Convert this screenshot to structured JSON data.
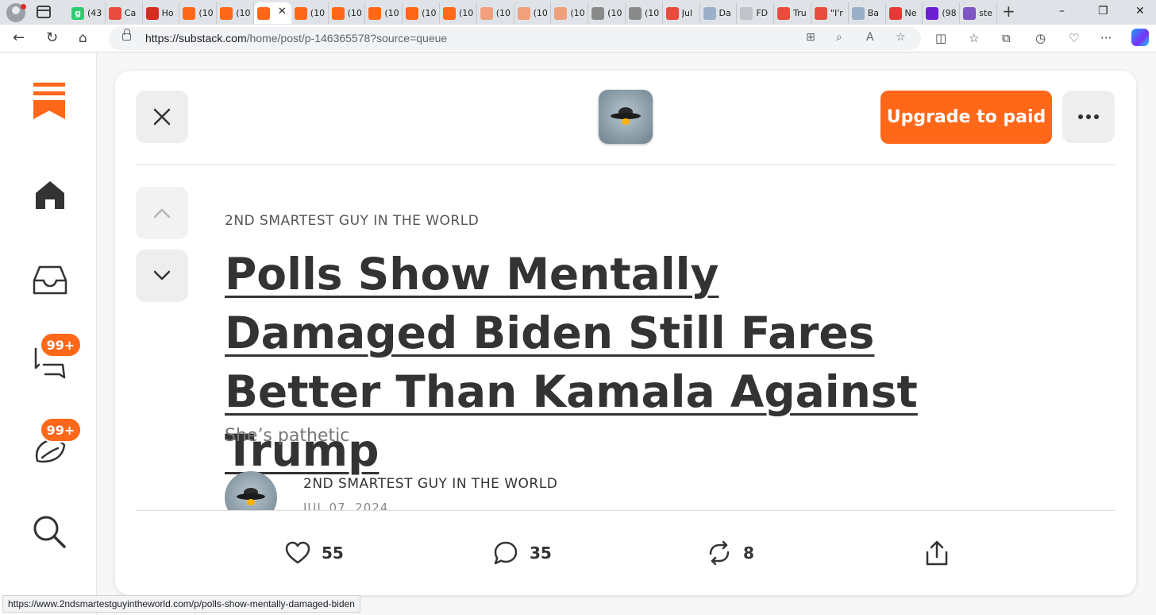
{
  "browser": {
    "tabs": [
      {
        "label": "(43",
        "color": "#2ecc71",
        "letter": "g"
      },
      {
        "label": "Ca",
        "color": "#e74c3c"
      },
      {
        "label": "Ho",
        "color": "#d62d20"
      },
      {
        "label": "(10",
        "color": "#ff6719"
      },
      {
        "label": "(10",
        "color": "#ff6719"
      },
      {
        "label": "",
        "color": "#ff6719",
        "active": true
      },
      {
        "label": "(10",
        "color": "#ff6719"
      },
      {
        "label": "(10",
        "color": "#ff6719"
      },
      {
        "label": "(10",
        "color": "#ff6719"
      },
      {
        "label": "(10",
        "color": "#ff6719"
      },
      {
        "label": "(10",
        "color": "#ff6719"
      },
      {
        "label": "(10",
        "color": "#f0a07a"
      },
      {
        "label": "(10",
        "color": "#f0a07a"
      },
      {
        "label": "(10",
        "color": "#f0a07a"
      },
      {
        "label": "(10",
        "color": "#8a8a8a"
      },
      {
        "label": "(10",
        "color": "#8a8a8a"
      },
      {
        "label": "Jul",
        "color": "#e74c3c"
      },
      {
        "label": "Da",
        "color": "#9ab0c8"
      },
      {
        "label": "FD",
        "color": "#c0c4c8"
      },
      {
        "label": "Tru",
        "color": "#e74c3c"
      },
      {
        "label": "\"I'r",
        "color": "#e74c3c"
      },
      {
        "label": "Ba",
        "color": "#9ab0c8"
      },
      {
        "label": "Ne",
        "color": "#e53935"
      },
      {
        "label": "(98",
        "color": "#6a1fd0"
      },
      {
        "label": "ste",
        "color": "#7e57c2"
      }
    ],
    "new_tab": "+",
    "window_controls": [
      "–",
      "❐",
      "✕"
    ],
    "url_host": "https://substack.com",
    "url_path": "/home/post/p-146365578?source=queue",
    "status_url": "https://www.2ndsmartestguyintheworld.com/p/polls-show-mentally-damaged-biden"
  },
  "sidebar": {
    "inbox_badge": "99+",
    "activity_badge": "99+"
  },
  "post": {
    "upgrade_label": "Upgrade to paid",
    "publication": "2ND SMARTEST GUY IN THE WORLD",
    "title": "Polls Show Mentally Damaged Biden Still Fares Better Than Kamala Against Trump",
    "subtitle": "She’s pathetic",
    "author": "2ND SMARTEST GUY IN THE WORLD",
    "date": "JUL 07, 2024"
  },
  "actions": {
    "likes": "55",
    "comments": "35",
    "restacks": "8"
  },
  "colors": {
    "brand": "#ff6719",
    "text": "#333333"
  }
}
